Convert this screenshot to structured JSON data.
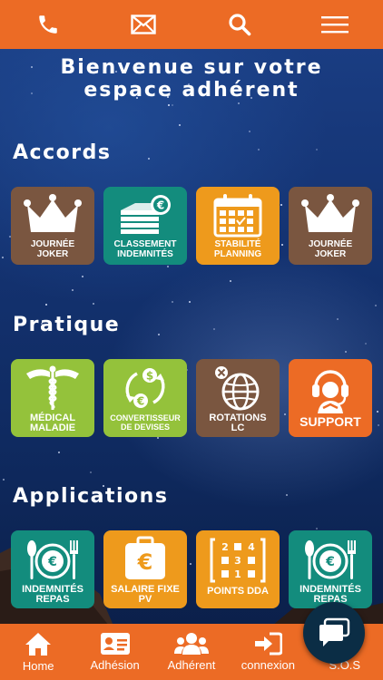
{
  "topbar": {
    "icons": [
      "phone-icon",
      "mail-icon",
      "search-icon",
      "menu-icon"
    ]
  },
  "welcome": {
    "line1": "Bienvenue sur votre",
    "line2": "espace adhérent"
  },
  "sections": {
    "accords": {
      "title": "Accords",
      "tiles": [
        {
          "label1": "JOURNÉE",
          "label2": "JOKER",
          "icon": "crown-icon",
          "color": "#7a5640"
        },
        {
          "label1": "CLASSEMENT",
          "label2": "INDEMNITÉS",
          "icon": "money-stack-icon",
          "color": "#138c7d"
        },
        {
          "label1": "STABILITÉ",
          "label2": "PLANNING",
          "icon": "calendar-icon",
          "color": "#ee9a1c"
        },
        {
          "label1": "JOURNÉE",
          "label2": "JOKER",
          "icon": "crown-icon",
          "color": "#7a5640"
        }
      ]
    },
    "pratique": {
      "title": "Pratique",
      "tiles": [
        {
          "label1": "MÉDICAL",
          "label2": "MALADIE",
          "icon": "caduceus-icon",
          "color": "#94c23b"
        },
        {
          "label1": "CONVERTISSEUR",
          "label2": "DE DEVISES",
          "icon": "currency-exchange-icon",
          "color": "#94c23b"
        },
        {
          "label1": "ROTATIONS",
          "label2": "LC",
          "icon": "globe-icon",
          "color": "#7a5640"
        },
        {
          "label1": "SUPPORT",
          "label2": "",
          "icon": "headset-icon",
          "color": "#ec6b25"
        }
      ]
    },
    "applications": {
      "title": "Applications",
      "tiles": [
        {
          "label1": "INDEMNITÉS",
          "label2": "REPAS",
          "icon": "meal-icon",
          "color": "#138c7d"
        },
        {
          "label1": "SALAIRE FIXE",
          "label2": "PV",
          "icon": "euro-wallet-icon",
          "color": "#ee9a1c"
        },
        {
          "label1": "POINTS DDA",
          "label2": "",
          "icon": "points-grid-icon",
          "color": "#ee9a1c"
        },
        {
          "label1": "INDEMNITÉS",
          "label2": "REPAS",
          "icon": "meal-icon",
          "color": "#138c7d"
        }
      ]
    }
  },
  "bottomnav": {
    "items": [
      {
        "label": "Home",
        "icon": "home-icon"
      },
      {
        "label": "Adhésion",
        "icon": "id-card-icon"
      },
      {
        "label": "Adhérent",
        "icon": "users-icon"
      },
      {
        "label": "connexion",
        "icon": "login-icon"
      },
      {
        "label": "S.O.S",
        "icon": "sos-icon"
      }
    ]
  },
  "colors": {
    "accent": "#ec6b25",
    "brown": "#7a5640",
    "teal": "#138c7d",
    "orange": "#ee9a1c",
    "green": "#94c23b",
    "chat": "#0b2d45"
  }
}
